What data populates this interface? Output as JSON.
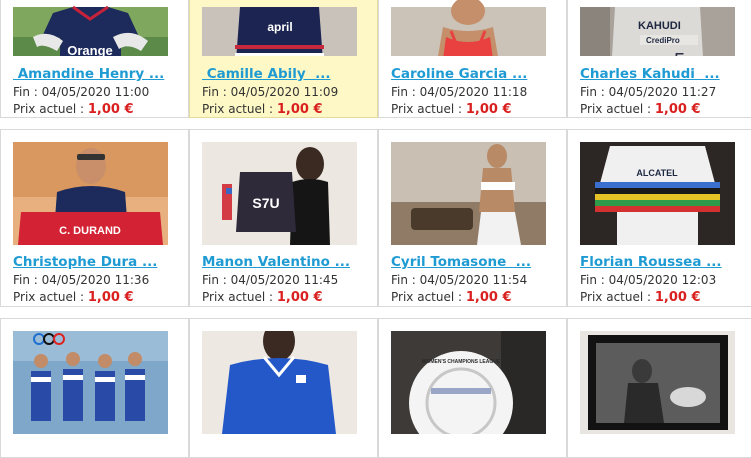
{
  "colors": {
    "link": "#1f9bd3",
    "price": "#d9201f",
    "highlight": "#fdf8c6",
    "text": "#333333",
    "border": "#d9d9d9"
  },
  "labels": {
    "end_prefix": "Fin : ",
    "price_prefix": "Prix actuel : "
  },
  "auctions": [
    {
      "title": " Amandine Henry ...",
      "end": "04/05/2020 11:00",
      "price": "1,00 €",
      "photo": "rugby-jersey-photo",
      "photo_text": "Orange"
    },
    {
      "title": " Camille Abily  ...",
      "end": "04/05/2020 11:09",
      "price": "1,00 €",
      "photo": "jersey-photo",
      "photo_text": "april",
      "highlighted": true
    },
    {
      "title": "Caroline Garcia ...",
      "end": "04/05/2020 11:18",
      "price": "1,00 €",
      "photo": "athlete-photo"
    },
    {
      "title": "Charles Kahudi  ...",
      "end": "04/05/2020 11:27",
      "price": "1,00 €",
      "photo": "basketball-jersey-photo",
      "photo_text": "KAHUDI"
    },
    {
      "title": "Christophe Dura ...",
      "end": "04/05/2020 11:36",
      "price": "1,00 €",
      "photo": "man-with-jersey-photo",
      "photo_text": "C. DURAND"
    },
    {
      "title": "Manon Valentino ...",
      "end": "04/05/2020 11:45",
      "price": "1,00 €",
      "photo": "woman-with-jersey-photo",
      "photo_text": "S7U"
    },
    {
      "title": "Cyril Tomasone  ...",
      "end": "04/05/2020 11:54",
      "price": "1,00 €",
      "photo": "gymnast-photo"
    },
    {
      "title": "Florian Roussea ...",
      "end": "04/05/2020 12:03",
      "price": "1,00 €",
      "photo": "cycling-jersey-photo",
      "photo_text": "ALCATEL"
    },
    {
      "photo": "rowing-team-photo"
    },
    {
      "photo": "french-jersey-photo"
    },
    {
      "photo": "football-photo",
      "photo_text": "WOMEN'S CHAMPIONS LEAGUE"
    },
    {
      "photo": "framed-rugby-photo"
    }
  ]
}
